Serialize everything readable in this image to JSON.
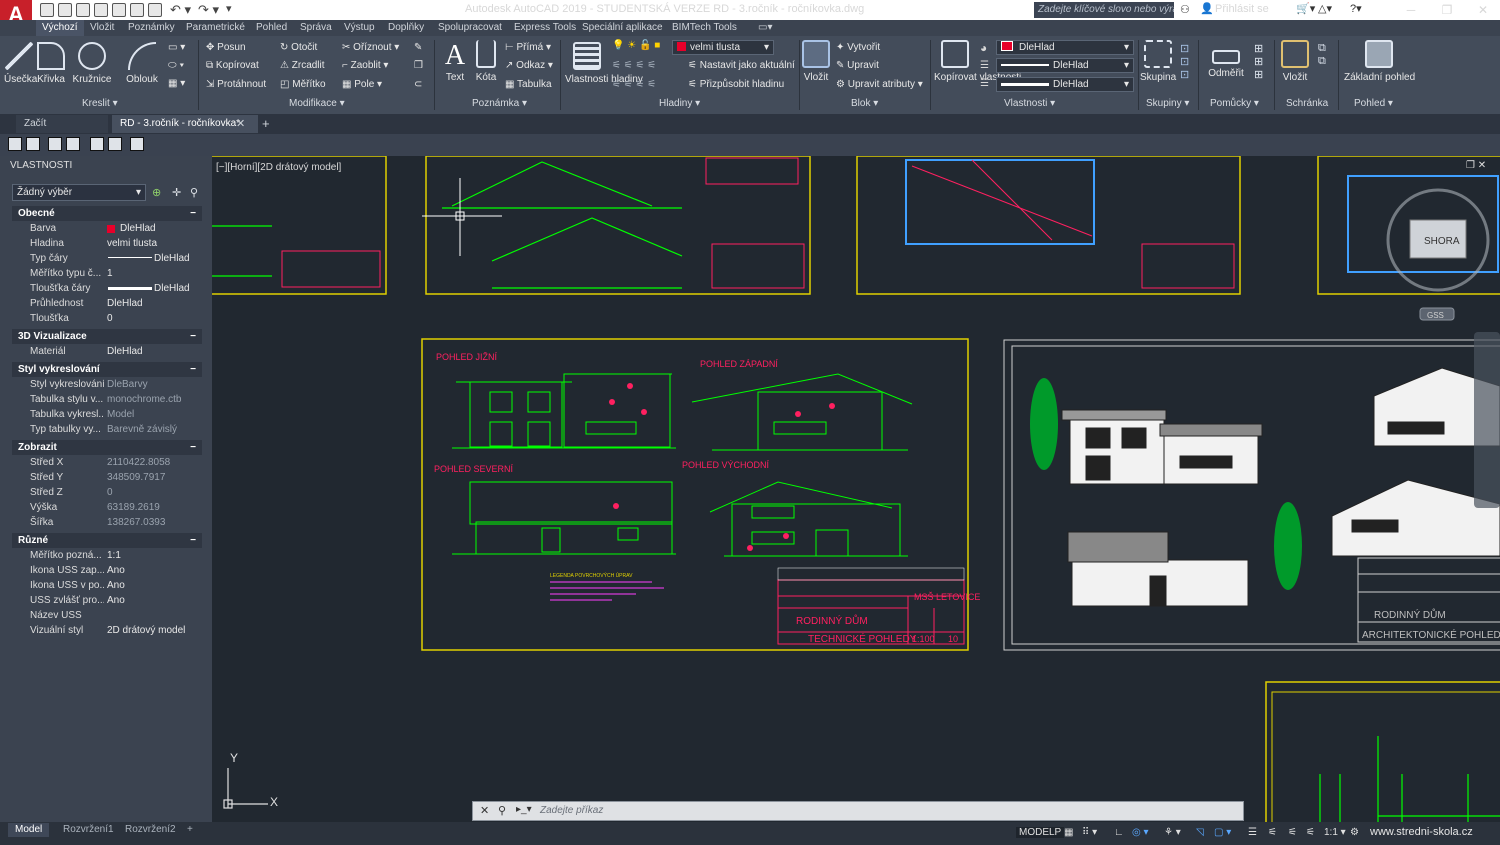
{
  "app": {
    "title": "Autodesk AutoCAD 2019 - STUDENTSKÁ VERZE    RD - 3.ročník - ročníkovka.dwg",
    "logo": "A",
    "search_placeholder": "Zadejte klíčové slovo nebo výraz.",
    "signin": "Přihlásit se"
  },
  "ribbon_tabs": [
    "Výchozí",
    "Vložit",
    "Poznámky",
    "Parametrické",
    "Pohled",
    "Správa",
    "Výstup",
    "Doplňky",
    "Spolupracovat",
    "Express Tools",
    "Speciální aplikace",
    "BIMTech Tools"
  ],
  "draw": {
    "line": "Úsečka",
    "polyline": "Křivka",
    "circle": "Kružnice",
    "arc": "Oblouk",
    "label": "Kreslit"
  },
  "modify": {
    "move": "Posun",
    "rotate": "Otočit",
    "trim": "Oříznout",
    "copy": "Kopírovat",
    "mirror": "Zrcadlit",
    "fillet": "Zaoblit",
    "stretch": "Protáhnout",
    "scale": "Měřítko",
    "array": "Pole",
    "label": "Modifikace"
  },
  "annotation": {
    "text": "Text",
    "dim": "Kóta",
    "linear": "Přímá",
    "leader": "Odkaz",
    "table": "Tabulka",
    "label": "Poznámka"
  },
  "layers": {
    "props": "Vlastnosti hladiny",
    "current": "velmi tlusta",
    "make_current": "Nastavit jako aktuální",
    "match": "Přizpůsobit hladinu",
    "label": "Hladiny"
  },
  "block": {
    "insert": "Vložit",
    "create": "Vytvořit",
    "edit": "Upravit",
    "edit_attr": "Upravit atributy",
    "label": "Blok"
  },
  "properties": {
    "match": "Kopírovat vlastnosti",
    "color": "DleHlad",
    "linetype": "DleHlad",
    "lineweight": "DleHlad",
    "label": "Vlastnosti"
  },
  "groups": {
    "group": "Skupina",
    "label": "Skupiny"
  },
  "utilities": {
    "measure": "Odměřit",
    "label": "Pomůcky"
  },
  "clipboard": {
    "paste": "Vložit",
    "label": "Schránka"
  },
  "view": {
    "base": "Základní pohled",
    "label": "Pohled"
  },
  "doc_tabs": [
    "Začít",
    "RD - 3.ročník - ročníkovka*"
  ],
  "palette": {
    "title": "VLASTNOSTI",
    "selection": "Žádný výběr",
    "sections": [
      {
        "name": "Obecné",
        "rows": [
          [
            "Barva",
            "DleHlad"
          ],
          [
            "Hladina",
            "velmi tlusta"
          ],
          [
            "Typ čáry",
            "DleHlad"
          ],
          [
            "Měřítko typu č...",
            "1"
          ],
          [
            "Tloušťka čáry",
            "DleHlad"
          ],
          [
            "Průhlednost",
            "DleHlad"
          ],
          [
            "Tloušťka",
            "0"
          ]
        ]
      },
      {
        "name": "3D Vizualizace",
        "rows": [
          [
            "Materiál",
            "DleHlad"
          ]
        ]
      },
      {
        "name": "Styl vykreslování",
        "rows": [
          [
            "Styl vykreslování",
            "DleBarvy"
          ],
          [
            "Tabulka stylu v...",
            "monochrome.ctb"
          ],
          [
            "Tabulka vykresl...",
            "Model"
          ],
          [
            "Typ tabulky vy...",
            "Barevně závislý"
          ]
        ]
      },
      {
        "name": "Zobrazit",
        "rows": [
          [
            "Střed X",
            "2110422.8058"
          ],
          [
            "Střed Y",
            "348509.7917"
          ],
          [
            "Střed Z",
            "0"
          ],
          [
            "Výška",
            "63189.2619"
          ],
          [
            "Šířka",
            "138267.0393"
          ]
        ]
      },
      {
        "name": "Různé",
        "rows": [
          [
            "Měřítko pozná...",
            "1:1"
          ],
          [
            "Ikona USS zap...",
            "Ano"
          ],
          [
            "Ikona USS v po...",
            "Ano"
          ],
          [
            "USS zvlášť pro...",
            "Ano"
          ],
          [
            "Název USS",
            ""
          ],
          [
            "Vizuální styl",
            "2D drátový model"
          ]
        ]
      }
    ]
  },
  "viewport": {
    "label": "[−][Horní][2D drátový model]",
    "viewcube": "SHORA",
    "gss": "GSS",
    "ucs_x": "X",
    "ucs_y": "Y"
  },
  "drawing": {
    "south": "POHLED  JIŽNÍ",
    "west": "POHLED  ZÁPADNÍ",
    "north": "POHLED  SEVERNÍ",
    "east": "POHLED  VÝCHODNÍ",
    "legend": "LEGENDA POVRCHOVÝCH ÚPRAV",
    "school": "MSŠ LETOVICE",
    "house": "RODINNÝ  DŮM",
    "sheet": "TECHNICKÉ  POHLEDY",
    "scale": "1:100",
    "sheetno": "10",
    "house2": "RODINNÝ  DŮM",
    "sheet2": "ARCHITEKTONICKÉ  POHLEDY"
  },
  "command": {
    "placeholder": "Zadejte příkaz"
  },
  "layout_tabs": [
    "Model",
    "Rozvržení1",
    "Rozvržení2"
  ],
  "status": {
    "model": "MODELP",
    "scale": "1:1"
  },
  "watermark": "www.stredni-skola.cz"
}
